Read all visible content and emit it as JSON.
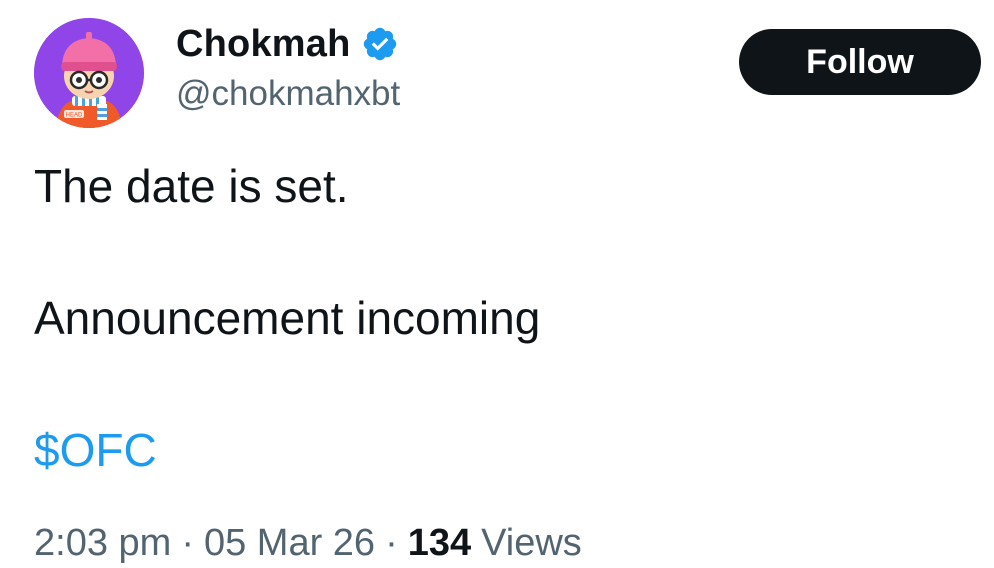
{
  "author": {
    "display_name": "Chokmah",
    "handle": "@chokmahxbt",
    "verified": true,
    "avatar_badge_text": "HEAD"
  },
  "actions": {
    "follow_label": "Follow"
  },
  "tweet": {
    "line1": "The date is set.",
    "line2": "Announcement incoming",
    "cashtag": "$OFC"
  },
  "meta": {
    "time": "2:03 pm",
    "date": "05 Mar 26",
    "views_count": "134",
    "views_label": "Views",
    "separator": "·"
  },
  "colors": {
    "accent": "#1d9bf0",
    "text": "#0f1419",
    "muted": "#536471",
    "avatar_bg": "#8f45e8",
    "follow_bg": "#0f1419"
  },
  "icons": {
    "verified": "verified-badge-icon",
    "avatar": "cartoon-avatar"
  }
}
